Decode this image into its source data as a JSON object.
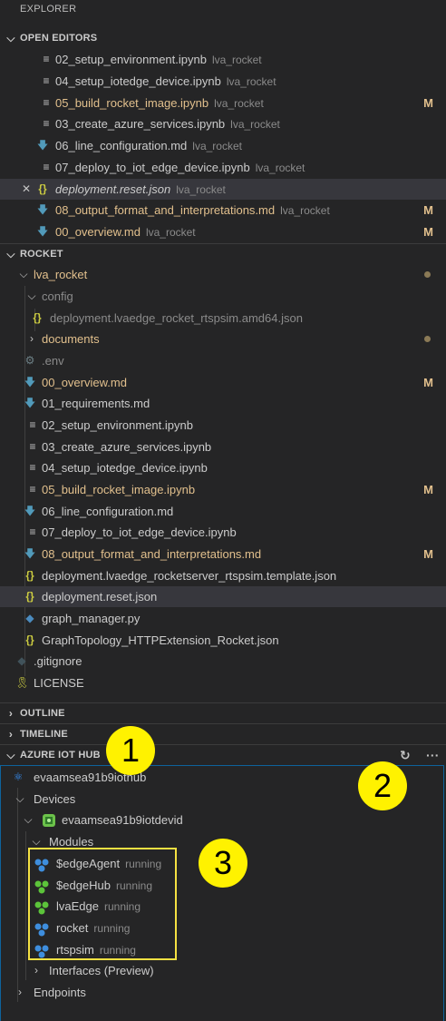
{
  "explorer": {
    "title": "EXPLORER"
  },
  "open_editors": {
    "header": "OPEN EDITORS",
    "items": [
      {
        "name": "02_setup_environment.ipynb",
        "folder": "lva_rocket",
        "badge": ""
      },
      {
        "name": "04_setup_iotedge_device.ipynb",
        "folder": "lva_rocket",
        "badge": ""
      },
      {
        "name": "05_build_rocket_image.ipynb",
        "folder": "lva_rocket",
        "badge": "M"
      },
      {
        "name": "03_create_azure_services.ipynb",
        "folder": "lva_rocket",
        "badge": ""
      },
      {
        "name": "06_line_configuration.md",
        "folder": "lva_rocket",
        "badge": ""
      },
      {
        "name": "07_deploy_to_iot_edge_device.ipynb",
        "folder": "lva_rocket",
        "badge": ""
      },
      {
        "name": "deployment.reset.json",
        "folder": "lva_rocket",
        "badge": ""
      },
      {
        "name": "08_output_format_and_interpretations.md",
        "folder": "lva_rocket",
        "badge": "M"
      },
      {
        "name": "00_overview.md",
        "folder": "lva_rocket",
        "badge": "M"
      }
    ]
  },
  "rocket": {
    "header": "ROCKET",
    "root": "lva_rocket",
    "config": "config",
    "config_file": "deployment.lvaedge_rocket_rtspsim.amd64.json",
    "documents": "documents",
    "files": [
      ".env",
      "00_overview.md",
      "01_requirements.md",
      "02_setup_environment.ipynb",
      "03_create_azure_services.ipynb",
      "04_setup_iotedge_device.ipynb",
      "05_build_rocket_image.ipynb",
      "06_line_configuration.md",
      "07_deploy_to_iot_edge_device.ipynb",
      "08_output_format_and_interpretations.md",
      "deployment.lvaedge_rocketserver_rtspsim.template.json",
      "deployment.reset.json",
      "graph_manager.py",
      "GraphTopology_HTTPExtension_Rocket.json"
    ],
    "root_files": [
      ".gitignore",
      "LICENSE"
    ],
    "badges": {
      "modified": "M"
    }
  },
  "outline": {
    "header": "OUTLINE"
  },
  "timeline": {
    "header": "TIMELINE"
  },
  "iot_hub": {
    "header": "AZURE IOT HUB",
    "hub": "evaamsea91b9iothub",
    "devices_label": "Devices",
    "device": "evaamsea91b9iotdevid",
    "modules_label": "Modules",
    "modules": [
      {
        "name": "$edgeAgent",
        "status": "running"
      },
      {
        "name": "$edgeHub",
        "status": "running"
      },
      {
        "name": "lvaEdge",
        "status": "running"
      },
      {
        "name": "rocket",
        "status": "running"
      },
      {
        "name": "rtspsim",
        "status": "running"
      }
    ],
    "interfaces": "Interfaces (Preview)",
    "endpoints": "Endpoints"
  },
  "callouts": [
    "1",
    "2",
    "3"
  ],
  "colors": {
    "sidebar_bg": "#252526",
    "modified": "#e2c08d",
    "callout": "#fff200",
    "selected_row": "#37373d"
  }
}
